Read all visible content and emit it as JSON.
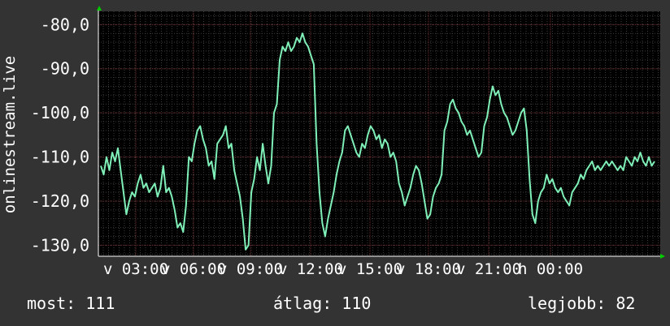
{
  "chart_data": {
    "type": "line",
    "ylabel": "onlinestream.live",
    "ylim": [
      -132.5,
      -77
    ],
    "y_ticks": [
      -80,
      -90,
      -100,
      -110,
      -120,
      -130
    ],
    "y_tick_labels": [
      "-80,0",
      "-90,0",
      "-100,0",
      "-110,0",
      "-120,0",
      "-130,0"
    ],
    "x_tick_labels": [
      "v 03:00",
      "v 06:00",
      "v 09:00",
      "v 12:00",
      "v 15:00",
      "v 18:00",
      "v 21:00",
      "h 00:00"
    ],
    "grid": true,
    "colors": {
      "background": "#333333",
      "plot": "#000000",
      "grid_minor": "#3a3a3a",
      "grid_major": "#6b2a2a",
      "line": "#7ff0b8",
      "text": "#ffffff",
      "arrow": "#00cc00"
    },
    "series": [
      {
        "values": [
          -112,
          -114,
          -110,
          -113,
          -109,
          -111,
          -108,
          -113,
          -118,
          -123,
          -120,
          -118,
          -119,
          -116,
          -114,
          -117,
          -116,
          -118,
          -117,
          -116,
          -119,
          -117,
          -112,
          -118,
          -117,
          -119,
          -122,
          -126,
          -125,
          -127,
          -121,
          -110,
          -111,
          -107,
          -104,
          -103,
          -106,
          -108,
          -112,
          -111,
          -115,
          -107,
          -106,
          -105,
          -103,
          -108,
          -107,
          -113,
          -116,
          -119,
          -124,
          -131,
          -130,
          -118,
          -115,
          -110,
          -113,
          -107,
          -112,
          -116,
          -112,
          -100,
          -98,
          -88,
          -85,
          -86,
          -84,
          -86,
          -85,
          -83,
          -84,
          -82,
          -84,
          -85,
          -87,
          -89,
          -107,
          -118,
          -125,
          -128,
          -124,
          -121,
          -118,
          -114,
          -111,
          -109,
          -104,
          -103,
          -105,
          -107,
          -109,
          -110,
          -107,
          -108,
          -105,
          -103,
          -104,
          -106,
          -105,
          -108,
          -106,
          -107,
          -110,
          -109,
          -111,
          -116,
          -118,
          -121,
          -119,
          -117,
          -114,
          -112,
          -113,
          -116,
          -120,
          -124,
          -123,
          -119,
          -117,
          -116,
          -114,
          -104,
          -102,
          -98,
          -97,
          -99,
          -100,
          -102,
          -103,
          -105,
          -104,
          -106,
          -108,
          -110,
          -109,
          -103,
          -101,
          -97,
          -94,
          -96,
          -95,
          -98,
          -100,
          -101,
          -103,
          -105,
          -104,
          -102,
          -100,
          -99,
          -104,
          -115,
          -123,
          -125,
          -120,
          -118,
          -117,
          -114,
          -116,
          -115,
          -117,
          -118,
          -117,
          -119,
          -120,
          -121,
          -118,
          -117,
          -116,
          -114,
          -115,
          -113,
          -112,
          -111,
          -113,
          -112,
          -113,
          -112,
          -111,
          -112,
          -111,
          -112,
          -113,
          -112,
          -113,
          -110,
          -111,
          -112,
          -110,
          -111,
          -109,
          -111,
          -112,
          -110,
          -112,
          -111
        ]
      }
    ]
  },
  "footer": {
    "current": "most: 111",
    "average": "átlag: 110",
    "best": "legjobb: 82"
  }
}
